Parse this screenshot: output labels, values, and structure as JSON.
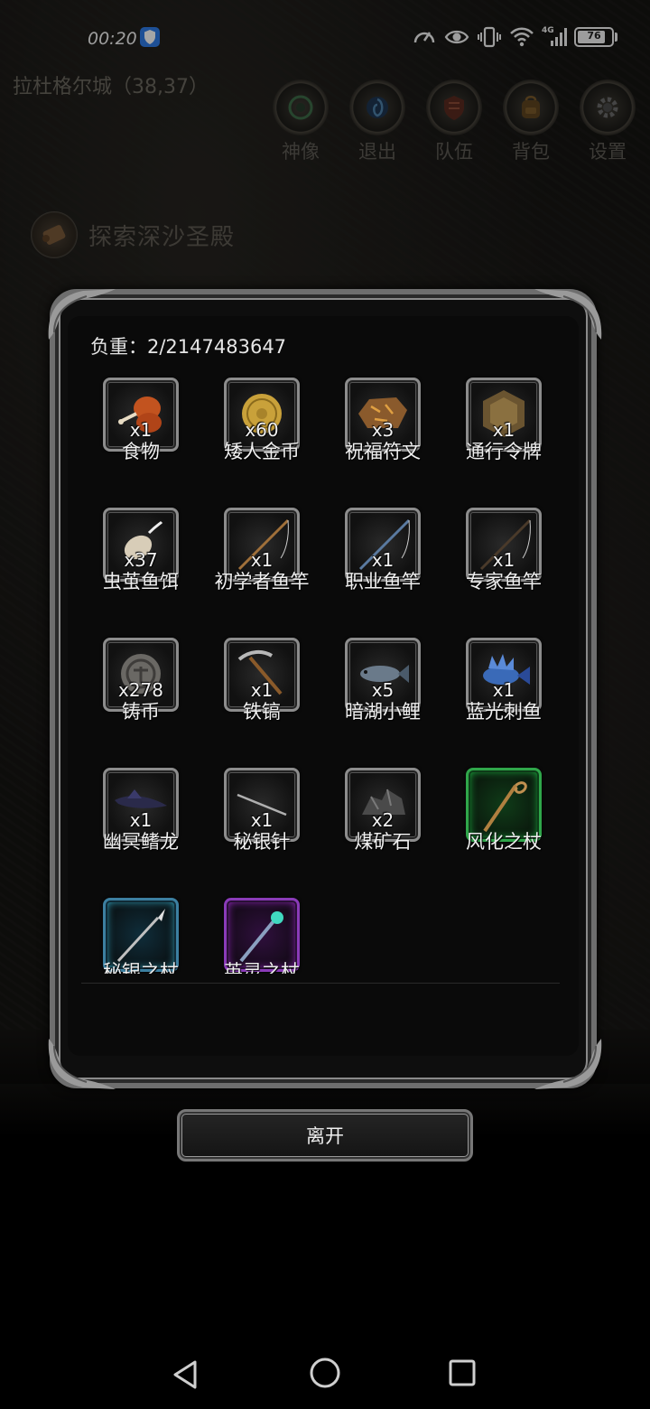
{
  "status_bar": {
    "time": "00:20",
    "battery_level": "76",
    "network": "4G",
    "icons": [
      "shield-icon",
      "speedometer-icon",
      "eye-icon",
      "vibrate-icon",
      "wifi-icon",
      "signal-icon",
      "battery-icon"
    ]
  },
  "header": {
    "location": "拉杜格尔城（38,37）",
    "menu": [
      {
        "label": "神像",
        "icon": "statue-icon"
      },
      {
        "label": "退出",
        "icon": "exit-portal-icon"
      },
      {
        "label": "队伍",
        "icon": "team-shield-icon"
      },
      {
        "label": "背包",
        "icon": "backpack-icon"
      },
      {
        "label": "设置",
        "icon": "gear-icon"
      }
    ]
  },
  "quest": {
    "title": "探索深沙圣殿",
    "icon": "scroll-icon"
  },
  "inventory": {
    "weight_label": "负重：2/2147483647",
    "items": [
      {
        "name": "食物",
        "qty": "x1",
        "icon": "meat-icon"
      },
      {
        "name": "矮人金币",
        "qty": "x60",
        "icon": "gold-coin-icon"
      },
      {
        "name": "祝福符文",
        "qty": "x3",
        "icon": "rune-stone-icon"
      },
      {
        "name": "通行令牌",
        "qty": "x1",
        "icon": "token-icon"
      },
      {
        "name": "虫茧鱼饵",
        "qty": "x37",
        "icon": "cocoon-bait-icon"
      },
      {
        "name": "初学者鱼竿",
        "qty": "x1",
        "icon": "fishing-rod-icon"
      },
      {
        "name": "职业鱼竿",
        "qty": "x1",
        "icon": "fishing-rod-blue-icon"
      },
      {
        "name": "专家鱼竿",
        "qty": "x1",
        "icon": "fishing-rod-dark-icon"
      },
      {
        "name": "铸币",
        "qty": "x278",
        "icon": "silver-coin-icon"
      },
      {
        "name": "铁镐",
        "qty": "x1",
        "icon": "pickaxe-icon"
      },
      {
        "name": "暗湖小鲤",
        "qty": "x5",
        "icon": "carp-icon"
      },
      {
        "name": "蓝光刺鱼",
        "qty": "x1",
        "icon": "spiny-fish-icon"
      },
      {
        "name": "幽冥鳍龙",
        "qty": "x1",
        "icon": "fin-dragon-icon"
      },
      {
        "name": "秘银针",
        "qty": "x1",
        "icon": "needle-icon"
      },
      {
        "name": "煤矿石",
        "qty": "x2",
        "icon": "coal-ore-icon"
      },
      {
        "name": "风化之杖",
        "qty": "",
        "icon": "wooden-staff-icon"
      },
      {
        "name": "秘银之杖",
        "qty": "",
        "icon": "spear-icon"
      },
      {
        "name": "英灵之杖",
        "qty": "",
        "icon": "crystal-staff-icon"
      }
    ]
  },
  "leave_button": "离开",
  "colors": {
    "rare_green": "#2fa64a",
    "rare_blue": "#3c7fa0",
    "rare_purple": "#8a3bb8"
  }
}
